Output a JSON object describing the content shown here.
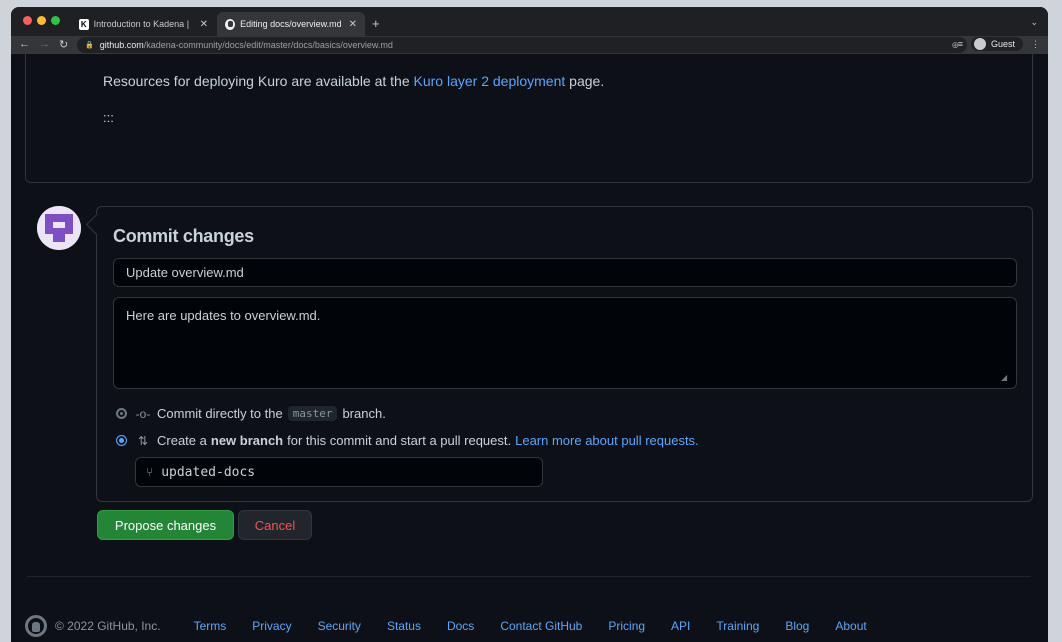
{
  "browser": {
    "tabs": [
      {
        "title": "Introduction to Kadena | Kaden",
        "favicon": "K",
        "active": false
      },
      {
        "title": "Editing docs/overview.md at m",
        "favicon": "github-icon",
        "active": true
      }
    ],
    "url_host": "github.com",
    "url_path": "/kadena-community/docs/edit/master/docs/basics/overview.md",
    "profile_label": "Guest"
  },
  "preview": {
    "text_before": "Resources for deploying Kuro are available at the ",
    "link_text": "Kuro layer 2 deployment",
    "text_after": " page.",
    "colons": ":::"
  },
  "commit": {
    "title": "Commit changes",
    "summary_value": "Update overview.md",
    "description_value": "Here are updates to overview.md.",
    "option_direct": {
      "prefix": "Commit directly to the",
      "branch": "master",
      "suffix": "branch.",
      "selected": false
    },
    "option_new_branch": {
      "prefix": "Create a",
      "bold": "new branch",
      "suffix": "for this commit and start a pull request.",
      "link": "Learn more about pull requests.",
      "selected": true
    },
    "branch_name": "updated-docs",
    "propose_label": "Propose changes",
    "cancel_label": "Cancel"
  },
  "footer": {
    "copyright": "© 2022 GitHub, Inc.",
    "links": [
      "Terms",
      "Privacy",
      "Security",
      "Status",
      "Docs",
      "Contact GitHub",
      "Pricing",
      "API",
      "Training",
      "Blog",
      "About"
    ]
  },
  "colors": {
    "background": "#0d1117",
    "accent_link": "#58a6ff",
    "primary_button": "#238636",
    "danger_text": "#f85149"
  }
}
